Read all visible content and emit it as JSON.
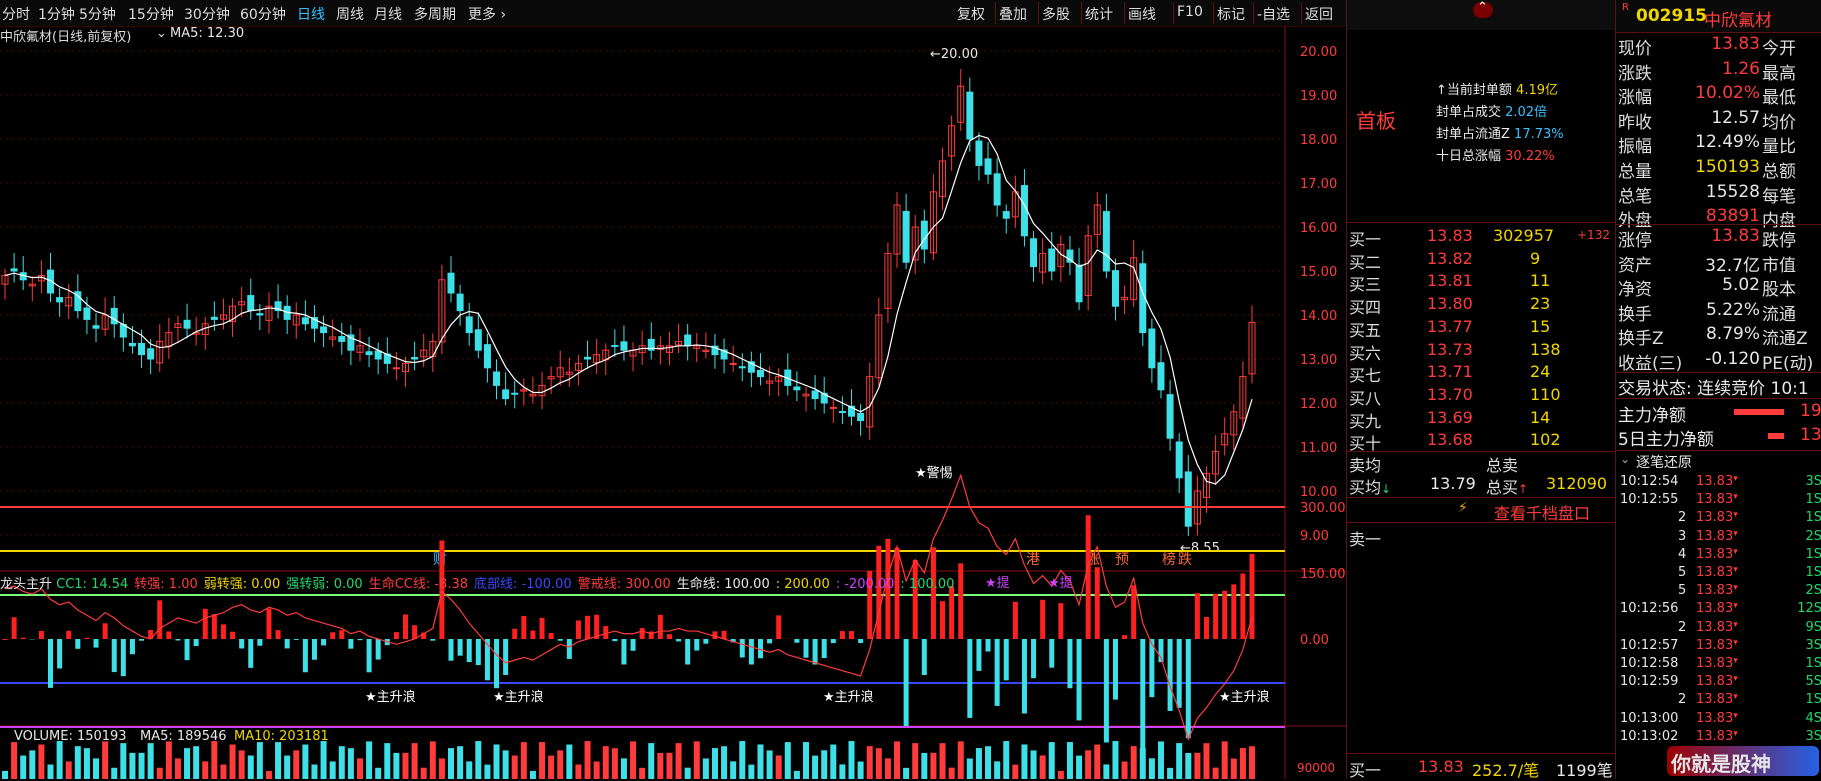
{
  "toolbar": {
    "periods": [
      "分时",
      "1分钟",
      "5分钟",
      "15分钟",
      "30分钟",
      "60分钟",
      "日线",
      "周线",
      "月线",
      "多周期",
      "更多"
    ],
    "active_period": "日线",
    "tools": [
      "复权",
      "叠加",
      "多股",
      "统计",
      "画线",
      "F10",
      "标记",
      "-自选",
      "返回"
    ]
  },
  "chart_header": {
    "name": "中欣氟材(日线,前复权)",
    "ma_label": "MA5: 12.30"
  },
  "price_axis": {
    "ticks": [
      "20.00",
      "19.00",
      "18.00",
      "17.00",
      "16.00",
      "15.00",
      "14.00",
      "13.00",
      "12.00",
      "11.00",
      "10.00",
      "9.00"
    ]
  },
  "annotations": {
    "high": "20.00",
    "low": "8.55",
    "events": [
      "财",
      "港",
      "涨",
      "预",
      "榜",
      "跌"
    ]
  },
  "indicator": {
    "name": "龙头主升",
    "params": [
      {
        "label": "CC1: 14.54",
        "color": "#22d86b"
      },
      {
        "label": "转强: 1.00",
        "color": "#ff3b3b"
      },
      {
        "label": "弱转强: 0.00",
        "color": "#f2d600"
      },
      {
        "label": "强转弱: 0.00",
        "color": "#22d86b"
      },
      {
        "label": "生命CC线: -8.38",
        "color": "#ff3b3b"
      },
      {
        "label": "底部线: -100.00",
        "color": "#3a48ff"
      },
      {
        "label": "警戒线: 300.00",
        "color": "#ff3b3b"
      },
      {
        "label": "生命线: 100.00",
        "color": "#e8e8e8"
      },
      {
        "label": ": 200.00",
        "color": "#f2d600"
      },
      {
        "label": ": -200.00",
        "color": "#d040ff"
      },
      {
        "label": ": 100.00",
        "color": "#22d86b"
      }
    ],
    "axis": [
      "300.00",
      "150.00",
      "0.00"
    ],
    "markers": [
      "★主升浪",
      "★主升浪",
      "★主升浪",
      "★主升浪",
      "★警惕",
      "★提",
      "★提"
    ]
  },
  "volume_bar": {
    "label": "VOLUME: 150193",
    "ma5": "MA5: 189546",
    "ma10": "MA10: 203181",
    "axis": "90000"
  },
  "stock": {
    "code": "002915",
    "name": "中欣氟材",
    "tag": "R"
  },
  "info_box": {
    "title": "首板",
    "items": [
      {
        "label": "当前封单额",
        "value": "4.19亿"
      },
      {
        "label": "封单占成交",
        "value": "2.02倍"
      },
      {
        "label": "封单占流通Z",
        "value": "17.73%"
      },
      {
        "label": "十日总涨幅",
        "value": "30.22%"
      }
    ]
  },
  "order_book": {
    "bids": [
      {
        "label": "买一",
        "price": "13.83",
        "volume": "302957",
        "extra": "+132"
      },
      {
        "label": "买二",
        "price": "13.82",
        "volume": "9",
        "extra": ""
      },
      {
        "label": "买三",
        "price": "13.81",
        "volume": "11",
        "extra": ""
      },
      {
        "label": "买四",
        "price": "13.80",
        "volume": "23",
        "extra": ""
      },
      {
        "label": "买五",
        "price": "13.77",
        "volume": "15",
        "extra": ""
      },
      {
        "label": "买六",
        "price": "13.73",
        "volume": "138",
        "extra": ""
      },
      {
        "label": "买七",
        "price": "13.71",
        "volume": "24",
        "extra": ""
      },
      {
        "label": "买八",
        "price": "13.70",
        "volume": "110",
        "extra": ""
      },
      {
        "label": "买九",
        "price": "13.69",
        "volume": "14",
        "extra": ""
      },
      {
        "label": "买十",
        "price": "13.68",
        "volume": "102",
        "extra": ""
      }
    ],
    "sell_avg_label": "卖均",
    "total_sell_label": "总卖",
    "buy_avg_label": "买均",
    "buy_avg": "13.79",
    "total_buy_label": "总买",
    "total_buy": "312090",
    "thousand_levels": "查看千档盘口",
    "ask1_label": "卖一",
    "bottom": {
      "label": "买一",
      "price": "13.83",
      "avg": "252.7/笔",
      "count": "1199笔"
    }
  },
  "quote": {
    "rows": [
      {
        "l1": "现价",
        "v1": "13.83",
        "c1": "#ff3b3b",
        "l2": "今开"
      },
      {
        "l1": "涨跌",
        "v1": "1.26",
        "c1": "#ff3b3b",
        "l2": "最高"
      },
      {
        "l1": "涨幅",
        "v1": "10.02%",
        "c1": "#ff3b3b",
        "l2": "最低"
      },
      {
        "l1": "昨收",
        "v1": "12.57",
        "c1": "#e8e8e8",
        "l2": "均价"
      },
      {
        "l1": "振幅",
        "v1": "12.49%",
        "c1": "#e8e8e8",
        "l2": "量比"
      },
      {
        "l1": "总量",
        "v1": "150193",
        "c1": "#f2d600",
        "l2": "总额"
      },
      {
        "l1": "总笔",
        "v1": "15528",
        "c1": "#e8e8e8",
        "l2": "每笔"
      },
      {
        "l1": "外盘",
        "v1": "83891",
        "c1": "#ff3b3b",
        "l2": "内盘"
      }
    ],
    "rows2": [
      {
        "l1": "涨停",
        "v1": "13.83",
        "c1": "#ff3b3b",
        "l2": "跌停"
      },
      {
        "l1": "资产",
        "v1": "32.7亿",
        "c1": "#e8e8e8",
        "l2": "市值"
      },
      {
        "l1": "净资",
        "v1": "5.02",
        "c1": "#e8e8e8",
        "l2": "股本"
      },
      {
        "l1": "换手",
        "v1": "5.22%",
        "c1": "#e8e8e8",
        "l2": "流通"
      },
      {
        "l1": "换手Z",
        "v1": "8.79%",
        "c1": "#e8e8e8",
        "l2": "流通Z"
      },
      {
        "l1": "收益(三)",
        "v1": "-0.120",
        "c1": "#e8e8e8",
        "l2": "PE(动)"
      }
    ],
    "trade_status": "交易状态: 连续竞价 10:1",
    "main_net": {
      "label": "主力净额",
      "value": "19"
    },
    "main_net5": {
      "label": "5日主力净额",
      "value": "13"
    }
  },
  "ticks": {
    "title": "逐笔还原",
    "rows": [
      {
        "time": "10:12:54",
        "price": "13.83",
        "vol": "3S"
      },
      {
        "time": "10:12:55",
        "price": "13.83",
        "vol": "1S"
      },
      {
        "time": "2",
        "price": "13.83",
        "vol": "1S"
      },
      {
        "time": "3",
        "price": "13.83",
        "vol": "2S"
      },
      {
        "time": "4",
        "price": "13.83",
        "vol": "1S"
      },
      {
        "time": "5",
        "price": "13.83",
        "vol": "1S"
      },
      {
        "time": "5",
        "price": "13.83",
        "vol": "2S"
      },
      {
        "time": "10:12:56",
        "price": "13.83",
        "vol": "12S"
      },
      {
        "time": "2",
        "price": "13.83",
        "vol": "9S"
      },
      {
        "time": "10:12:57",
        "price": "13.83",
        "vol": "3S"
      },
      {
        "time": "10:12:58",
        "price": "13.83",
        "vol": "1S"
      },
      {
        "time": "10:12:59",
        "price": "13.83",
        "vol": "5S"
      },
      {
        "time": "2",
        "price": "13.83",
        "vol": "1S"
      },
      {
        "time": "10:13:00",
        "price": "13.83",
        "vol": "4S"
      },
      {
        "time": "10:13:02",
        "price": "13.83",
        "vol": "3S"
      }
    ]
  },
  "watermark": "你就是股神",
  "colors": {
    "up": "#ff3b3b",
    "down": "#3ee0e8",
    "ma": "#ffffff",
    "grid": "#5a0a0a"
  }
}
